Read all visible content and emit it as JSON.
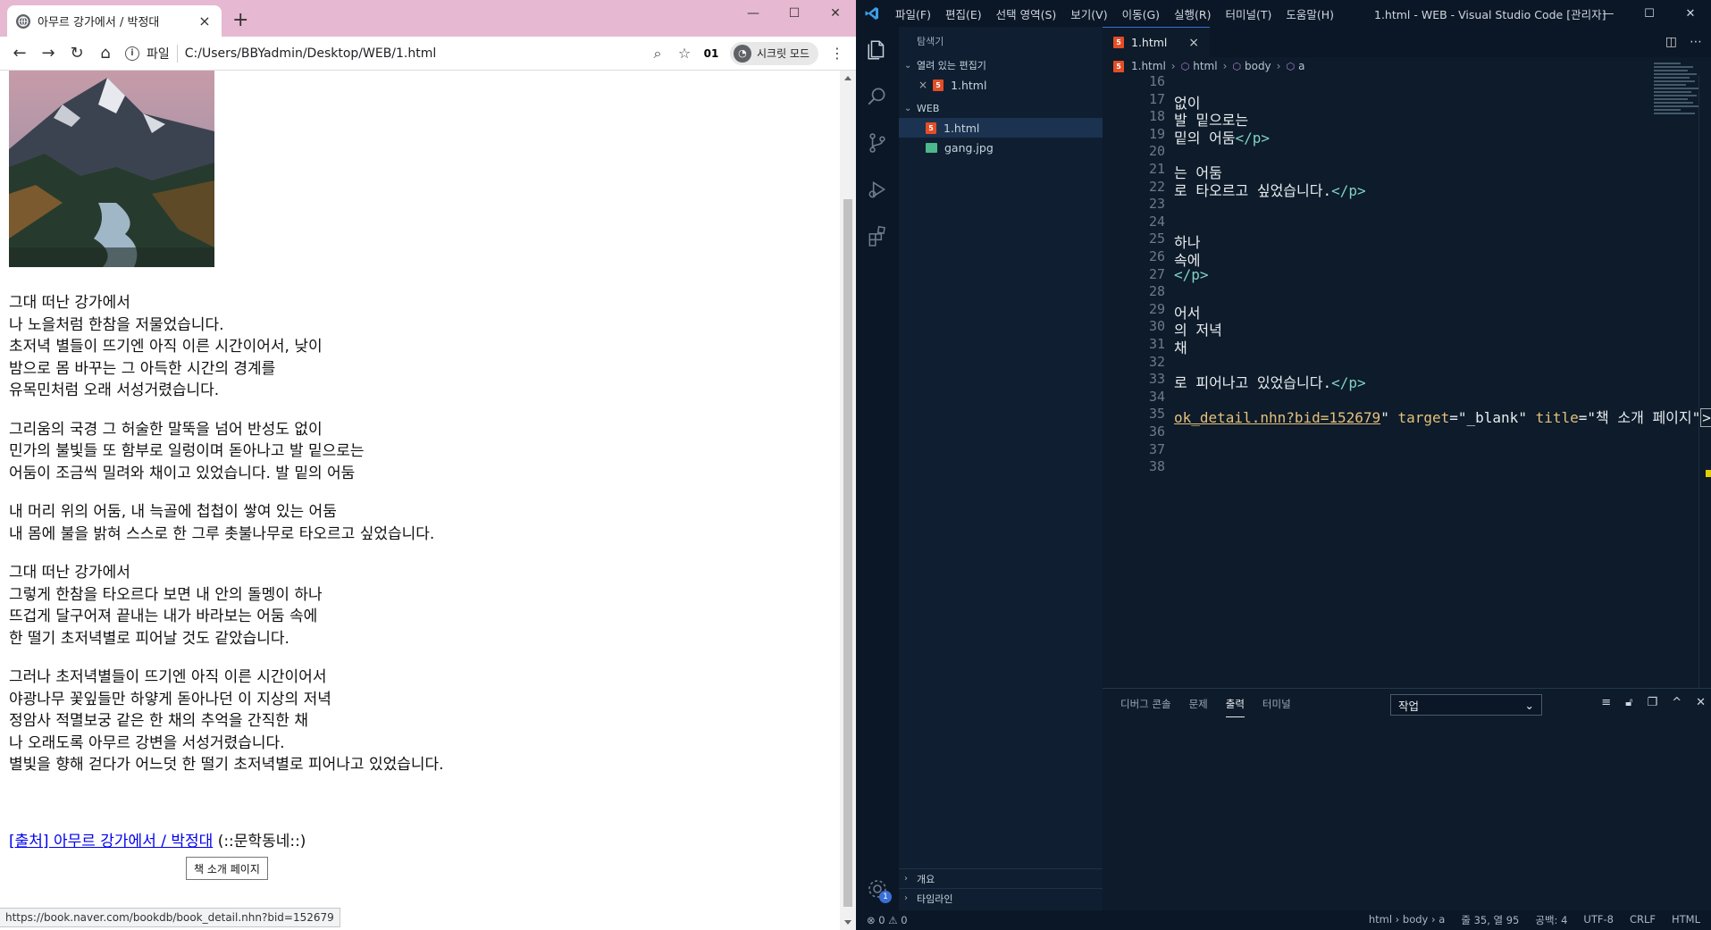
{
  "browser": {
    "tab_title": "아무르 강가에서 / 박정대",
    "new_tab": "+",
    "url_scheme": "파일",
    "url": "C:/Users/BBYadmin/Desktop/WEB/1.html",
    "extension_badge": "01",
    "incognito_label": "시크릿 모드",
    "page": {
      "stanzas": [
        [
          "그대 떠난 강가에서",
          "나 노을처럼 한참을 저물었습니다.",
          "초저녁 별들이 뜨기엔 아직 이른 시간이어서, 낮이",
          "밤으로 몸 바꾸는 그 아득한 시간의 경계를",
          "유목민처럼 오래 서성거렸습니다."
        ],
        [
          "그리움의 국경 그 허술한 말뚝을 넘어 반성도 없이",
          "민가의 불빛들 또 함부로 일렁이며 돋아나고 발 밑으로는",
          "어둠이 조금씩 밀려와 채이고 있었습니다. 발 밑의 어둠"
        ],
        [
          "내 머리 위의 어둠, 내 늑골에 첩첩이 쌓여 있는 어둠",
          "내 몸에 불을 밝혀 스스로 한 그루 촛불나무로 타오르고 싶었습니다."
        ],
        [
          "그대 떠난 강가에서",
          "그렇게 한참을 타오르다 보면 내 안의 돌멩이 하나",
          "뜨겁게 달구어져 끝내는 내가 바라보는 어둠 속에",
          "한 떨기 초저녁별로 피어날 것도 같았습니다."
        ],
        [
          "그러나 초저녁별들이 뜨기엔 아직 이른 시간이어서",
          "야광나무 꽃잎들만 하얗게 돋아나던 이 지상의 저녁",
          "정암사 적멸보궁 같은 한 채의 추억을 간직한 채",
          "나 오래도록 아무르 강변을 서성거렸습니다.",
          "별빛을 향해 걷다가 어느덧 한 떨기 초저녁별로 피어나고 있었습니다."
        ]
      ],
      "source_link": "[출처] 아무르 강가에서 / 박정대",
      "source_suffix": " (::문학동네::)",
      "book_button": "책 소개 페이지"
    },
    "status_url": "https://book.naver.com/bookdb/book_detail.nhn?bid=152679"
  },
  "vscode": {
    "menu": [
      "파일(F)",
      "편집(E)",
      "선택 영역(S)",
      "보기(V)",
      "이동(G)",
      "실행(R)",
      "터미널(T)",
      "도움말(H)"
    ],
    "window_title": "1.html - WEB - Visual Studio Code [관리자]",
    "explorer_title": "탐색기",
    "open_editors_label": "열려 있는 편집기",
    "open_editor_file": "1.html",
    "workspace_label": "WEB",
    "files": [
      "1.html",
      "gang.jpg"
    ],
    "outline_label": "개요",
    "timeline_label": "타임라인",
    "active_tab": "1.html",
    "breadcrumb": [
      "1.html",
      "html",
      "body",
      "a"
    ],
    "code_lines": [
      {
        "n": "16",
        "t": ""
      },
      {
        "n": "17",
        "t": "없이"
      },
      {
        "n": "18",
        "t": "발 밑으로는"
      },
      {
        "n": "19",
        "t": "밑의 어둠</p>"
      },
      {
        "n": "20",
        "t": ""
      },
      {
        "n": "21",
        "t": "는 어둠"
      },
      {
        "n": "22",
        "t": "로 타오르고 싶었습니다.</p>"
      },
      {
        "n": "23",
        "t": ""
      },
      {
        "n": "24",
        "t": ""
      },
      {
        "n": "25",
        "t": "하나"
      },
      {
        "n": "26",
        "t": "속에"
      },
      {
        "n": "27",
        "t": "</p>"
      },
      {
        "n": "28",
        "t": ""
      },
      {
        "n": "29",
        "t": "어서"
      },
      {
        "n": "30",
        "t": "의 저녁"
      },
      {
        "n": "31",
        "t": "채"
      },
      {
        "n": "32",
        "t": ""
      },
      {
        "n": "33",
        "t": "로 피어나고 있었습니다.</p>"
      },
      {
        "n": "34",
        "t": ""
      },
      {
        "n": "35",
        "t": "ok_detail.nhn?bid=152679\" target=\"_blank\" title=\"책 소개 페이지\">"
      },
      {
        "n": "36",
        "t": ""
      },
      {
        "n": "37",
        "t": ""
      },
      {
        "n": "38",
        "t": ""
      }
    ],
    "panel_tabs": [
      "디버그 콘솔",
      "문제",
      "출력",
      "터미널"
    ],
    "panel_active": "출력",
    "output_select": "작업",
    "status_left": "⊗ 0 ⚠ 0",
    "status_right": [
      "html › body › a",
      "줄 35, 열 95",
      "공백: 4",
      "UTF-8",
      "CRLF",
      "HTML"
    ],
    "settings_badge": "1"
  }
}
